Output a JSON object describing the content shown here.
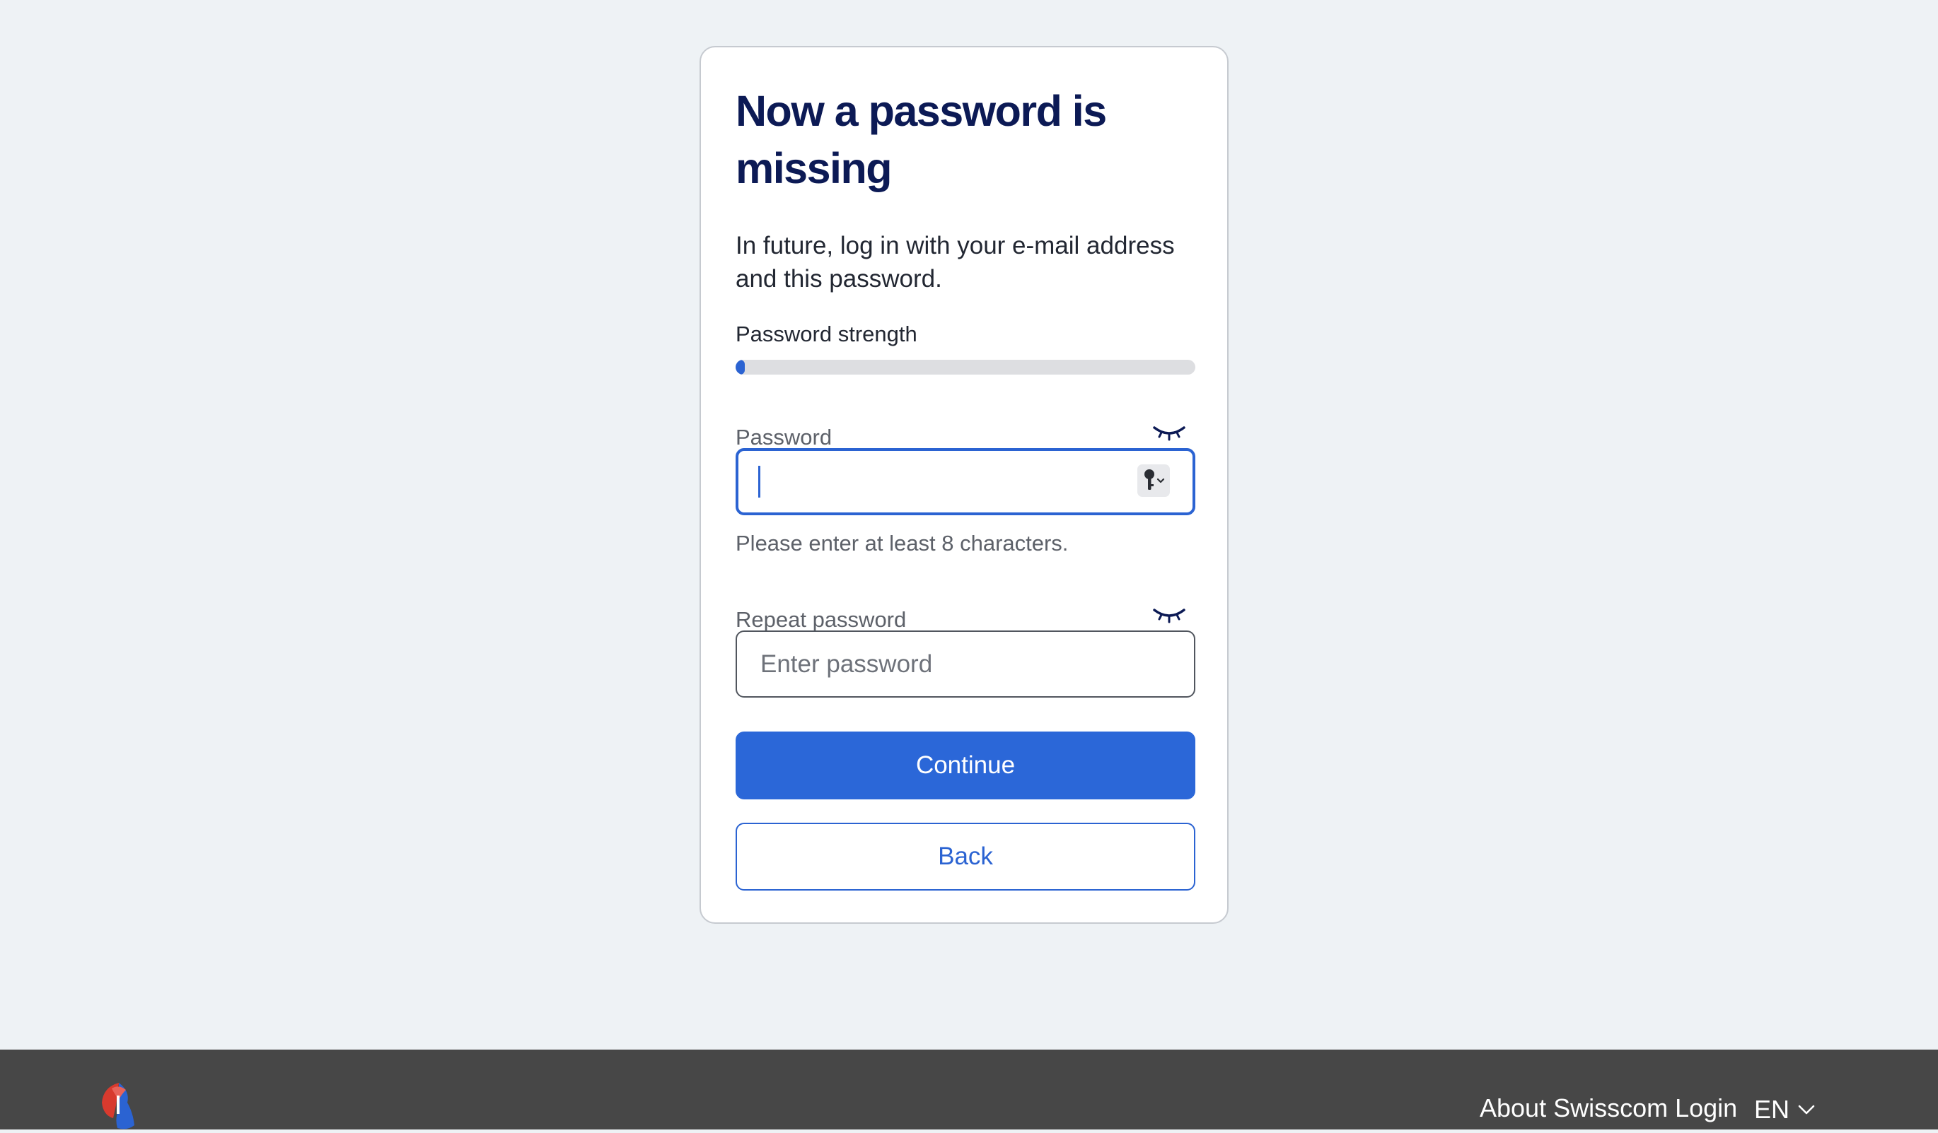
{
  "card": {
    "title": "Now a password is missing",
    "intro": "In future, log in with your e-mail address and this password.",
    "strength": {
      "label": "Password strength",
      "level_percent": 2,
      "color": "#2b63d2"
    },
    "password": {
      "label": "Password",
      "value": "",
      "toggle_icon": "eye-closed-icon",
      "autofill_icon": "key-icon",
      "helper": "Please enter at least 8 characters."
    },
    "repeat_password": {
      "label": "Repeat password",
      "placeholder": "Enter password",
      "toggle_icon": "eye-closed-icon"
    },
    "continue_label": "Continue",
    "back_label": "Back"
  },
  "footer": {
    "about_link": "About Swisscom Login",
    "language": "EN",
    "logo_icon": "swisscom-logo"
  },
  "colors": {
    "accent": "#2b63d2",
    "title": "#0c1a55",
    "background": "#eef2f5",
    "footer": "#474747"
  }
}
